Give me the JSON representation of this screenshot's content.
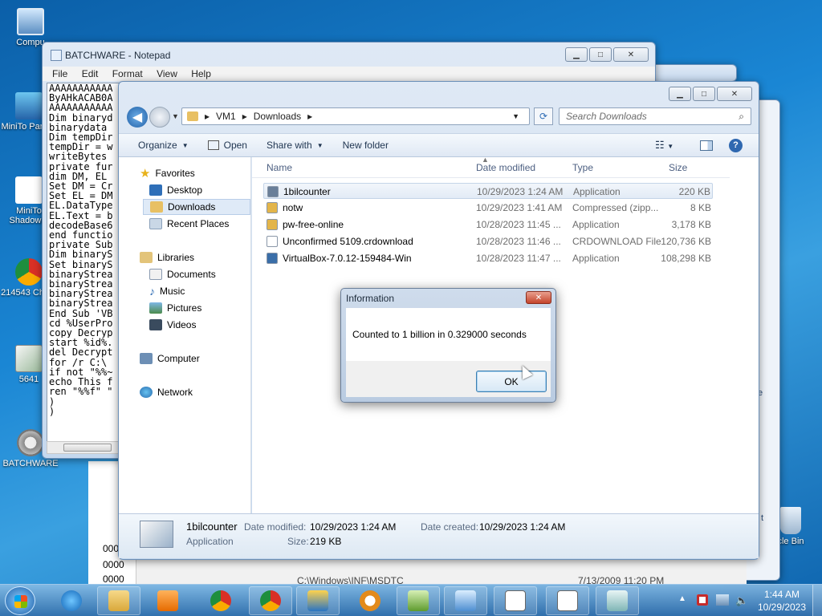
{
  "desktop": {
    "icons": [
      {
        "label": "Compu"
      },
      {
        "label": "MiniTo Partitio"
      },
      {
        "label": "MiniTo ShadowM"
      },
      {
        "label": "214543 Chron"
      },
      {
        "label": "5641"
      },
      {
        "label": "BATCHWARE"
      }
    ],
    "right_labels": {
      "recycle": "cle Bin",
      "e": "e",
      "t": "t"
    }
  },
  "notepad": {
    "title": "BATCHWARE - Notepad",
    "menu": [
      "File",
      "Edit",
      "Format",
      "View",
      "Help"
    ],
    "lines": [
      "AAAAAAAAAAA",
      "ByAHkACAB0A",
      "AAAAAAAAAAA",
      "Dim binaryd",
      "binarydata ",
      "Dim tempDir",
      "tempDir = w",
      "writeBytes ",
      "private fur",
      "dim DM, EL ",
      "Set DM = Cr",
      "Set EL = DM",
      "EL.DataType",
      "EL.Text = b",
      "decodeBase6",
      "end functio",
      "private Sub",
      "Dim binaryS",
      "Set binaryS",
      "binaryStrea",
      "binaryStrea",
      "binaryStrea",
      "binaryStrea",
      "End Sub 'VB",
      "cd %UserPro",
      "copy Decryp",
      "start %id%.",
      "del Decrypt",
      "for /r C:\\ ",
      "if not \"%%~",
      "echo This f",
      "ren \"%%f\" \"",
      ")",
      ")"
    ]
  },
  "explorer": {
    "breadcrumb": [
      "VM1",
      "Downloads"
    ],
    "search_placeholder": "Search Downloads",
    "toolbar": {
      "organize": "Organize",
      "open": "Open",
      "share": "Share with",
      "new_folder": "New folder"
    },
    "nav": {
      "favorites": "Favorites",
      "desktop": "Desktop",
      "downloads": "Downloads",
      "recent": "Recent Places",
      "libraries": "Libraries",
      "documents": "Documents",
      "music": "Music",
      "pictures": "Pictures",
      "videos": "Videos",
      "computer": "Computer",
      "network": "Network"
    },
    "columns": {
      "name": "Name",
      "date": "Date modified",
      "type": "Type",
      "size": "Size"
    },
    "files": [
      {
        "name": "1bilcounter",
        "date": "10/29/2023 1:24 AM",
        "type": "Application",
        "size": "220 KB",
        "color": "#6a7f99"
      },
      {
        "name": "notw",
        "date": "10/29/2023 1:41 AM",
        "type": "Compressed (zipp...",
        "size": "8 KB",
        "color": "#e3b54a"
      },
      {
        "name": "pw-free-online",
        "date": "10/28/2023 11:45 ...",
        "type": "Application",
        "size": "3,178 KB",
        "color": "#e3b54a"
      },
      {
        "name": "Unconfirmed 5109.crdownload",
        "date": "10/28/2023 11:46 ...",
        "type": "CRDOWNLOAD File",
        "size": "120,736 KB",
        "color": "#ffffff"
      },
      {
        "name": "VirtualBox-7.0.12-159484-Win",
        "date": "10/28/2023 11:47 ...",
        "type": "Application",
        "size": "108,298 KB",
        "color": "#3a6ea8"
      }
    ],
    "details": {
      "name": "1bilcounter",
      "modified_label": "Date modified:",
      "modified": "10/29/2023 1:24 AM",
      "created_label": "Date created:",
      "created": "10/29/2023 1:24 AM",
      "type": "Application",
      "size_label": "Size:",
      "size": "219 KB"
    }
  },
  "background_window": {
    "text": "C:\\Windows\\INF\\MSDTC",
    "date": "7/13/2009 11:20 PM",
    "rows": [
      "0000",
      "0000",
      "0000"
    ]
  },
  "dialog": {
    "title": "Information",
    "message": "Counted to 1 billion in 0.329000 seconds",
    "ok": "OK"
  },
  "taskbar": {
    "time": "1:44 AM",
    "date": "10/29/2023"
  }
}
